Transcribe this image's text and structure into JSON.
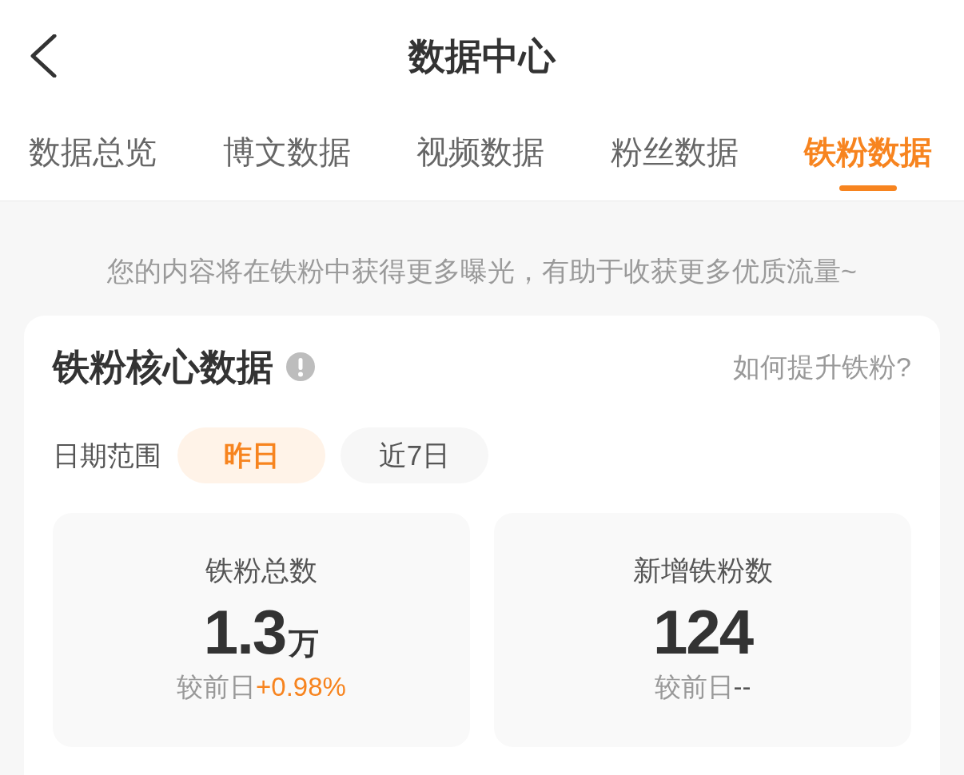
{
  "header": {
    "title": "数据中心"
  },
  "tabs": [
    {
      "label": "数据总览",
      "selected": false
    },
    {
      "label": "博文数据",
      "selected": false
    },
    {
      "label": "视频数据",
      "selected": false
    },
    {
      "label": "粉丝数据",
      "selected": false
    },
    {
      "label": "铁粉数据",
      "selected": true
    }
  ],
  "notice": "您的内容将在铁粉中获得更多曝光，有助于收获更多优质流量~",
  "core_card": {
    "title": "铁粉核心数据",
    "help_link": "如何提升铁粉?",
    "date_range": {
      "label": "日期范围",
      "options": [
        {
          "label": "昨日",
          "selected": true
        },
        {
          "label": "近7日",
          "selected": false
        }
      ]
    },
    "stats": [
      {
        "label": "铁粉总数",
        "value": "1.3",
        "unit": "万",
        "compare_label": "较前日",
        "change": "+0.98%",
        "color": "#f7841f"
      },
      {
        "label": "新增铁粉数",
        "value": "124",
        "compare_label": "较前日",
        "change": "--",
        "color": "#555555"
      }
    ]
  }
}
